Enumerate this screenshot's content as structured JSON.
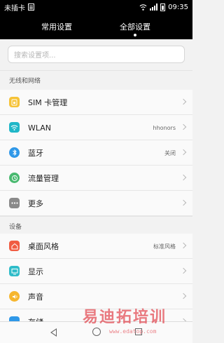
{
  "status_bar": {
    "carrier": "未插卡",
    "time": "09:35"
  },
  "tabs": [
    {
      "label": "常用设置"
    },
    {
      "label": "全部设置"
    }
  ],
  "search": {
    "placeholder": "搜索设置项..."
  },
  "sections": [
    {
      "title": "无线和网络"
    },
    {
      "title": "设备"
    }
  ],
  "items": [
    {
      "label": "SIM 卡管理",
      "value": "",
      "icon": "sim-card-icon",
      "color": "#f6c338"
    },
    {
      "label": "WLAN",
      "value": "hhonors",
      "icon": "wifi-icon",
      "color": "#20b7c8"
    },
    {
      "label": "蓝牙",
      "value": "关闭",
      "icon": "bluetooth-icon",
      "color": "#2f98e8"
    },
    {
      "label": "流量管理",
      "value": "",
      "icon": "data-usage-icon",
      "color": "#48b96f"
    },
    {
      "label": "更多",
      "value": "",
      "icon": "more-icon",
      "color": "#8a8a8a"
    },
    {
      "label": "桌面风格",
      "value": "标准风格",
      "icon": "home-style-icon",
      "color": "#f05c42"
    },
    {
      "label": "显示",
      "value": "",
      "icon": "display-icon",
      "color": "#2fbcc9"
    },
    {
      "label": "声音",
      "value": "",
      "icon": "sound-icon",
      "color": "#f6b62e"
    },
    {
      "label": "存储",
      "value": "",
      "icon": "storage-icon",
      "color": "#2f98e8"
    }
  ],
  "watermark": {
    "text": "易迪拓培训",
    "url": "www.edatop.com"
  }
}
